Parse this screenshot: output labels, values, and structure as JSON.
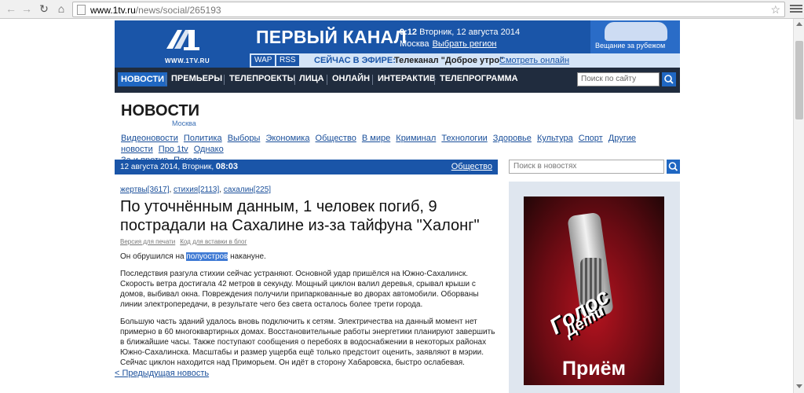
{
  "browser": {
    "url_host": "www.1tv.ru",
    "url_path": "/news/social/265193"
  },
  "header": {
    "logo_site": "WWW.1TV.RU",
    "channel_title": "ПЕРВЫЙ КАНАЛ",
    "time": "9:12",
    "date": "Вторник, 12 августа 2014",
    "city": "Москва",
    "choose_region": "Выбрать регион",
    "abroad": "Вещание за рубежом",
    "wap": "WAP",
    "rss": "RSS",
    "on_air_label": "СЕЙЧАС В ЭФИРЕ:",
    "on_air_show": "Телеканал \"Доброе утро\"",
    "watch_online": "Смотреть онлайн"
  },
  "nav": {
    "items": [
      "НОВОСТИ",
      "ПРЕМЬЕРЫ",
      "ТЕЛЕПРОЕКТЫ",
      "ЛИЦА",
      "ОНЛАЙН",
      "ИНТЕРАКТИВ",
      "ТЕЛЕПРОГРАММА"
    ],
    "search_placeholder": "Поиск по сайту"
  },
  "section": {
    "title": "НОВОСТИ",
    "subtitle": "Москва",
    "categories": [
      "Видеоновости",
      "Политика",
      "Выборы",
      "Экономика",
      "Общество",
      "В мире",
      "Криминал",
      "Технологии",
      "Здоровье",
      "Культура",
      "Спорт",
      "Другие новости",
      "Про 1tv",
      "Однако",
      "За и против",
      "Погода"
    ]
  },
  "article_bar": {
    "date": "12 августа 2014, Вторник,",
    "time": "08:03",
    "category": "Общество"
  },
  "news_search_placeholder": "Поиск в новостях",
  "article": {
    "tags": [
      "жертвы[3617]",
      "стихия[2113]",
      "сахалин[225]"
    ],
    "headline": "По уточнённым данным, 1 человек погиб, 9 пострадали на Сахалине из-за тайфуна \"Халонг\"",
    "print_version": "Версия для печати",
    "embed_code": "Код для вставки в блог",
    "p1_before": "Он обрушился на ",
    "p1_highlight": "полуостров",
    "p1_after": " накануне.",
    "p2": "Последствия разгула стихии сейчас устраняют. Основной удар пришёлся на Южно-Сахалинск. Скорость ветра достигала 42 метров в секунду. Мощный циклон валил деревья, срывал крыши с домов, выбивал окна. Повреждения получили припаркованные во дворах автомобили. Оборваны линии электропередачи, в результате чего без света осталось более трети города.",
    "p3": "Большую часть зданий удалось вновь подключить к сетям. Электричества на данный момент нет примерно в 60 многоквартирных домах. Восстановительные работы энергетики планируют завершить в ближайшие часы. Также поступают сообщения о перебоях в водоснабжении в некоторых районах Южно-Сахалинска. Масштабы и размер ущерба ещё только предстоит оценить, заявляют в мэрии. Сейчас циклон находится над Приморьем. Он идёт в сторону Хабаровска, быстро ослабевая.",
    "prev_link": "< Предыдущая новость"
  },
  "banner": {
    "line1": "Голос",
    "line2": "Дети",
    "line3": "Приём"
  },
  "colors": {
    "brand_blue": "#1a55a8",
    "nav_dark": "#202c3e",
    "link": "#1a4f9a"
  }
}
